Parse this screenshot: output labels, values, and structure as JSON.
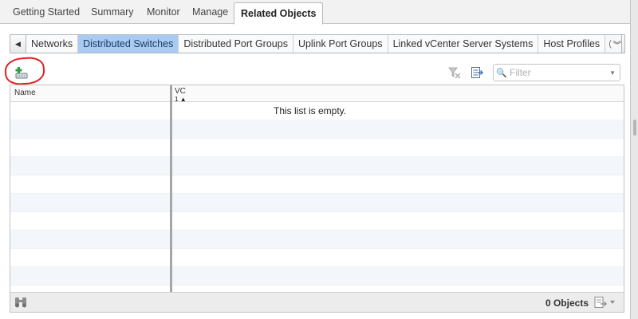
{
  "top_tabs": [
    {
      "label": "Getting Started"
    },
    {
      "label": "Summary"
    },
    {
      "label": "Monitor"
    },
    {
      "label": "Manage"
    },
    {
      "label": "Related Objects",
      "active": true
    }
  ],
  "sub_tabs": [
    {
      "label": "Networks"
    },
    {
      "label": "Distributed Switches",
      "active": true
    },
    {
      "label": "Distributed Port Groups"
    },
    {
      "label": "Uplink Port Groups"
    },
    {
      "label": "Linked vCenter Server Systems"
    },
    {
      "label": "Host Profiles"
    }
  ],
  "sub_tab_overflow": "(",
  "toolbar": {
    "add_icon": "add-distributed-switch-icon",
    "filter_placeholder": "Filter"
  },
  "grid": {
    "columns": [
      {
        "label": "Name"
      },
      {
        "label": "VC",
        "sort_index": "1",
        "sort_dir": "▲"
      }
    ],
    "empty_message": "This list is empty.",
    "row_count": 10
  },
  "footer": {
    "count_text": "0 Objects"
  },
  "colors": {
    "active_subtab_bg": "#a9cbf2",
    "annotation_circle": "#e02020"
  }
}
